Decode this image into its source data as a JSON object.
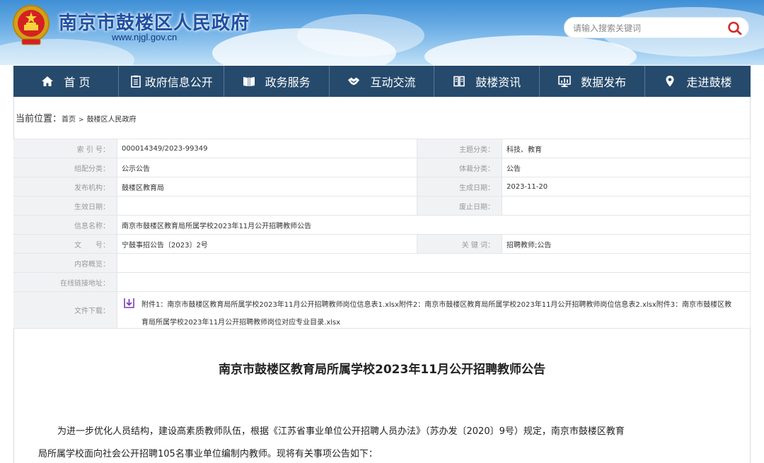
{
  "header": {
    "site_title": "南京市鼓楼区人民政府",
    "site_url": "www.njgl.gov.cn",
    "search_placeholder": "请输入搜索关键词"
  },
  "nav": {
    "items": [
      {
        "label": "首 页",
        "icon": "home-icon"
      },
      {
        "label": "政府信息公开",
        "icon": "document-icon"
      },
      {
        "label": "政务服务",
        "icon": "book-icon"
      },
      {
        "label": "互动交流",
        "icon": "handshake-icon"
      },
      {
        "label": "鼓楼资讯",
        "icon": "news-icon"
      },
      {
        "label": "数据发布",
        "icon": "monitor-icon"
      },
      {
        "label": "走进鼓楼",
        "icon": "location-icon"
      }
    ]
  },
  "breadcrumb": {
    "label": "当前位置：",
    "home": "首页",
    "sep": ">",
    "current": "鼓楼区人民政府"
  },
  "meta": {
    "index_label": "索 引 号：",
    "index_value": "000014349/2023-99349",
    "topic_label": "主题分类：",
    "topic_value": "科技、教育",
    "category_label": "组配分类：",
    "category_value": "公示公告",
    "genre_label": "体裁分类：",
    "genre_value": "公告",
    "publisher_label": "发布机构：",
    "publisher_value": "鼓楼区教育局",
    "created_label": "生成日期：",
    "created_value": "2023-11-20",
    "effective_label": "生效日期：",
    "effective_value": "",
    "abolish_label": "废止日期：",
    "abolish_value": "",
    "name_label": "信息名称：",
    "name_value": "南京市鼓楼区教育局所属学校2023年11月公开招聘教师公告",
    "doc_label": "文　　号：",
    "doc_value": "宁鼓事招公告〔2023〕2号",
    "keywords_label": "关 键 词：",
    "keywords_value": "招聘教师;公告",
    "summary_label": "内容概览：",
    "summary_value": "",
    "link_label": "在线链接地址：",
    "link_value": "",
    "download_label": "文件下载：",
    "download_line1": "附件1：南京市鼓楼区教育局所属学校2023年11月公开招聘教师岗位信息表1.xlsx附件2：南京市鼓楼区教育局所属学校2023年11月公开招聘教师岗位信息表2.xlsx附件3：南京市鼓楼区教",
    "download_line2": "育局所属学校2023年11月公开招聘教师岗位对应专业目录.xlsx"
  },
  "article": {
    "title": "南京市鼓楼区教育局所属学校2023年11月公开招聘教师公告",
    "para1_line1": "为进一步优化人员结构，建设高素质教师队伍，根据《江苏省事业单位公开招聘人员办法》（苏办发〔2020〕9号）规定，南京市鼓楼区教育",
    "para1_line2": "局所属学校面向社会公开招聘105名事业单位编制内教师。现将有关事项公告如下："
  },
  "colors": {
    "nav_bg": "#264a6c",
    "title_blue": "#1f4fa0",
    "search_icon": "#d42a2a",
    "download_icon": "#7a3fb3"
  }
}
